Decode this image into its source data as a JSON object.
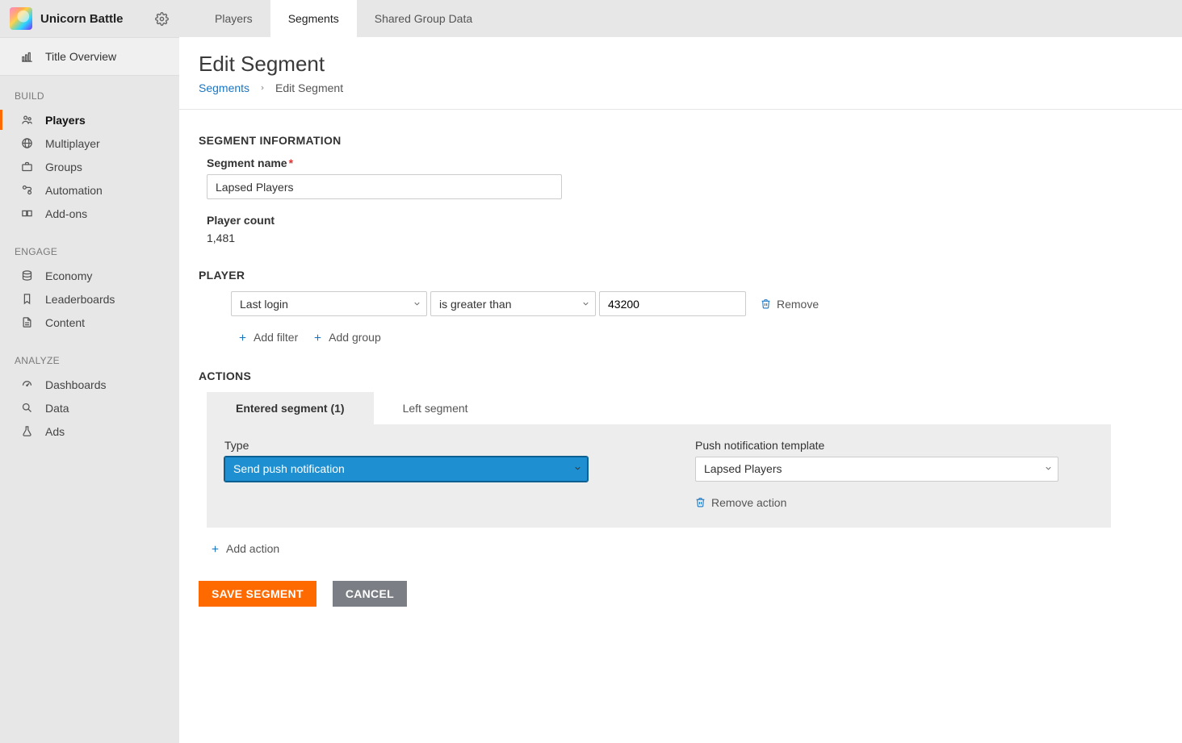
{
  "app": {
    "title_name": "Unicorn Battle"
  },
  "sidebar": {
    "title_overview": "Title Overview",
    "sections": {
      "build": {
        "label": "BUILD",
        "items": [
          "Players",
          "Multiplayer",
          "Groups",
          "Automation",
          "Add-ons"
        ]
      },
      "engage": {
        "label": "ENGAGE",
        "items": [
          "Economy",
          "Leaderboards",
          "Content"
        ]
      },
      "analyze": {
        "label": "ANALYZE",
        "items": [
          "Dashboards",
          "Data",
          "Ads"
        ]
      }
    }
  },
  "tabs": {
    "items": [
      "Players",
      "Segments",
      "Shared Group Data"
    ],
    "active": "Segments"
  },
  "page": {
    "title": "Edit Segment",
    "breadcrumb": {
      "root": "Segments",
      "current": "Edit Segment"
    }
  },
  "segment_info": {
    "heading": "SEGMENT INFORMATION",
    "name_label": "Segment name",
    "name_value": "Lapsed Players",
    "count_label": "Player count",
    "count_value": "1,481"
  },
  "player_filter": {
    "heading": "PLAYER",
    "field_select": "Last login",
    "op_select": "is greater than",
    "value": "43200",
    "remove_label": "Remove",
    "add_filter_label": "Add filter",
    "add_group_label": "Add group"
  },
  "actions": {
    "heading": "ACTIONS",
    "tabs": {
      "entered": "Entered segment (1)",
      "left": "Left segment"
    },
    "type_label": "Type",
    "type_value": "Send push notification",
    "template_label": "Push notification template",
    "template_value": "Lapsed Players",
    "remove_action_label": "Remove action",
    "add_action_label": "Add action"
  },
  "buttons": {
    "save": "SAVE SEGMENT",
    "cancel": "CANCEL"
  }
}
